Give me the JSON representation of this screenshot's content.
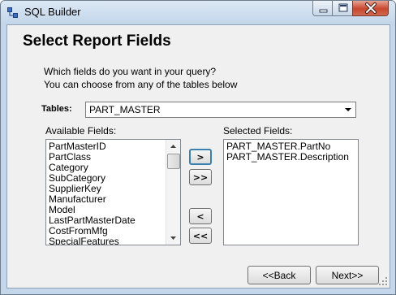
{
  "window": {
    "title": "SQL Builder"
  },
  "page": {
    "heading": "Select Report Fields",
    "description_line1": "Which fields do you want in your query?",
    "description_line2": "You can choose from any of the tables below"
  },
  "tables": {
    "label": "Tables:",
    "selected": "PART_MASTER"
  },
  "available_fields": {
    "label": "Available Fields:",
    "items": [
      "PartMasterID",
      "PartClass",
      "Category",
      "SubCategory",
      "SupplierKey",
      "Manufacturer",
      "Model",
      "LastPartMasterDate",
      "CostFromMfg",
      "SpecialFeatures"
    ]
  },
  "selected_fields": {
    "label": "Selected Fields:",
    "items": [
      "PART_MASTER.PartNo",
      "PART_MASTER.Description"
    ]
  },
  "move_buttons": {
    "add": ">",
    "add_all": ">>",
    "remove": "<",
    "remove_all": "<<"
  },
  "navigation": {
    "back": "<<Back",
    "next": "Next>>"
  }
}
